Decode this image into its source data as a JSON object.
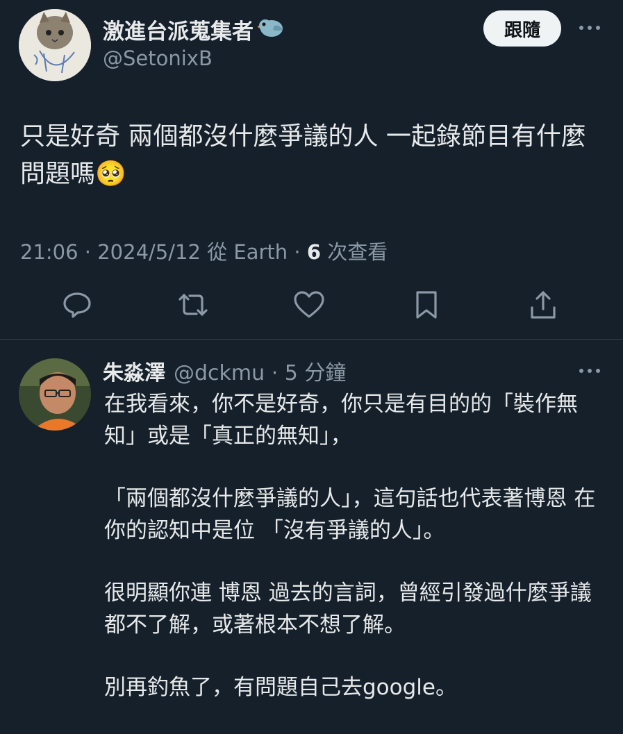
{
  "tweet": {
    "author_name": "激進台派蒐集者",
    "handle": "@SetonixB",
    "follow_label": "跟隨",
    "text": "只是好奇 兩個都沒什麼爭議的人 一起錄節目有什麼問題嗎🥺",
    "time": "21:06",
    "date": "2024/5/12",
    "source": "從 Earth",
    "views_count": "6",
    "views_label": "次查看"
  },
  "reply": {
    "author_name": "朱淼澤",
    "handle": "@dckmu",
    "age": "5 分鐘",
    "paragraphs": [
      "在我看來，你不是好奇，你只是有目的的「裝作無知」或是「真正的無知」，",
      "「兩個都沒什麼爭議的人」，這句話也代表著博恩 在你的認知中是位 「沒有爭議的人」。",
      "很明顯你連 博恩 過去的言詞，曾經引發過什麼爭議都不了解，或著根本不想了解。",
      "別再釣魚了，有問題自己去google。"
    ]
  },
  "icons": [
    "bird-emoji-icon",
    "more-icon",
    "reply-icon",
    "retweet-icon",
    "like-icon",
    "bookmark-icon",
    "share-icon"
  ],
  "colors": {
    "background": "#15202b",
    "text": "#e7e9ea",
    "secondary": "#8b98a5",
    "divider": "#38444d"
  }
}
